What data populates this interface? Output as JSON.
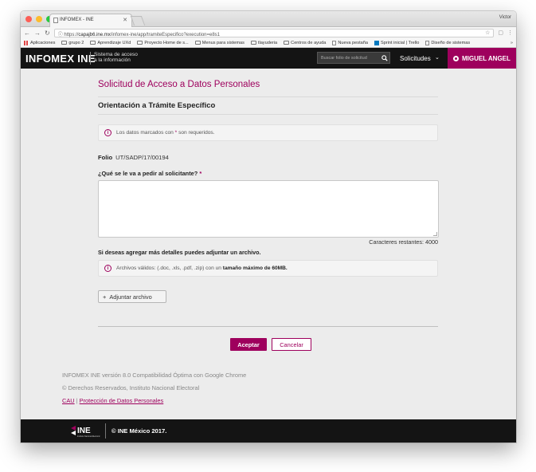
{
  "browser": {
    "tab_title": "INFOMEX - INE",
    "user_name": "Victor",
    "url_prefix": "https://",
    "url_host": "capajb6.ine.mx",
    "url_path": "/infomex-ine/app/tramiteEspecifico?execution=e8s1",
    "bookmarks": [
      "Aplicaciones",
      "grupo 2",
      "Aprendizaje UXd",
      "Proyecto Home de s...",
      "Menus para sistemas",
      "tlayuderia",
      "Centros de ayuda",
      "Nueva pestaña",
      "Sprint inicial | Trello",
      "Diseño de sistemas"
    ],
    "bookmarks_more": "»"
  },
  "nav": {
    "brand": "INFOMEX INE",
    "brand_sub_1": "Sistema de acceso",
    "brand_sub_2": "a la información",
    "search_placeholder": "Buscar folio de solicitud",
    "solicitudes": "Solicitudes",
    "user": "MIGUEL ANGEL"
  },
  "form": {
    "title": "Solicitud de Acceso a Datos Personales",
    "subtitle": "Orientación a Trámite Específico",
    "required_note_pre": "Los datos marcados con ",
    "required_mark": "*",
    "required_note_post": " son requeridos.",
    "folio_label": "Folio",
    "folio_value": "UT/SADP/17/00194",
    "question_label": "¿Qué se le va a pedir al solicitante?",
    "chars_remaining": "Caracteres restantes: 4000",
    "attach_label": "Si deseas agregar más detalles puedes adjuntar un archivo.",
    "files_note_pre": "Archivos válidos: (.doc, .xls, .pdf, .zip) con un ",
    "files_note_bold": "tamaño máximo de 60MB.",
    "attach_button": "Adjuntar archivo",
    "accept_button": "Aceptar",
    "cancel_button": "Cancelar"
  },
  "footer": {
    "version": "INFOMEX INE versión 8.0 Compatibilidad Óptima con Google Chrome",
    "rights": "© Derechos Reservados, Instituto Nacional Electoral",
    "link_cau": "CAU",
    "link_sep": "|",
    "link_privacy": "Protección de Datos Personales",
    "logo_text": "INE",
    "logo_caption": "Instituto Nacional Electoral",
    "copyright": "© INE México 2017."
  },
  "colors": {
    "accent": "#9e005d",
    "nav_bg": "#141414",
    "page_bg": "#ececec"
  }
}
